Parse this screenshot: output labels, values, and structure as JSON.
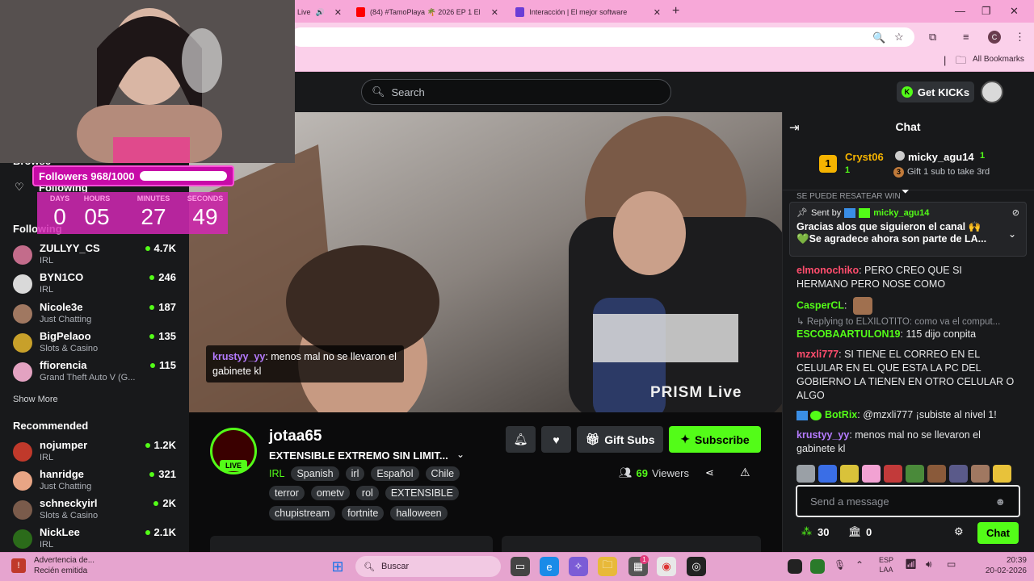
{
  "browser": {
    "tabs": [
      {
        "label": "(84) #TamoPlaya 🌴 2026 EP 1 El",
        "icon": "youtube-icon",
        "color": "#ff0000"
      },
      {
        "label": "Interacción | El mejor software",
        "icon": "app-icon",
        "color": "#6a3dd6"
      }
    ],
    "partial_tab_label": "Live",
    "bookmarks_label": "All Bookmarks",
    "profile_initial": "C"
  },
  "header": {
    "search_placeholder": "Search",
    "get_kicks_label": "Get KICKs"
  },
  "overlay": {
    "followers_label": "Followers 968/1000",
    "followers_progress": 0.968,
    "countdown": [
      {
        "label": "DAYS",
        "value": "0"
      },
      {
        "label": "HOURS",
        "value": "05"
      },
      {
        "label": "MINUTES",
        "value": "27"
      },
      {
        "label": "SECONDS",
        "value": "49"
      }
    ],
    "hidden_sidebar_fragment": "Browse",
    "following_nav_label": "Following"
  },
  "sidebar": {
    "following_heading": "Following",
    "following": [
      {
        "name": "ZULLYY_CS",
        "category": "IRL",
        "viewers": "4.7K",
        "color": "#c36c8b"
      },
      {
        "name": "BYN1CO",
        "category": "IRL",
        "viewers": "246",
        "color": "#d9d9d9"
      },
      {
        "name": "Nicole3e",
        "category": "Just Chatting",
        "viewers": "187",
        "color": "#a07861"
      },
      {
        "name": "BigPelaoo",
        "category": "Slots & Casino",
        "viewers": "135",
        "color": "#c8a02a"
      },
      {
        "name": "ffiorencia",
        "category": "Grand Theft Auto V (G...",
        "viewers": "115",
        "color": "#e3a2c1"
      }
    ],
    "show_more_label": "Show More",
    "recommended_heading": "Recommended",
    "recommended": [
      {
        "name": "nojumper",
        "category": "IRL",
        "viewers": "1.2K",
        "color": "#c0392b"
      },
      {
        "name": "hanridge",
        "category": "Just Chatting",
        "viewers": "321",
        "color": "#e8a585"
      },
      {
        "name": "schneckyirl",
        "category": "Slots & Casino",
        "viewers": "2K",
        "color": "#7a5b4b"
      },
      {
        "name": "NickLee",
        "category": "IRL",
        "viewers": "2.1K",
        "color": "#53fc18"
      }
    ]
  },
  "video": {
    "overlay_user": "krustyy_yy",
    "overlay_text": ": menos mal no se llevaron el gabinete kl",
    "watermark": "PRISM Live"
  },
  "channel": {
    "name": "jotaa65",
    "live_label": "LIVE",
    "title": "EXTENSIBLE EXTREMO SIN LIMIT...",
    "category": "IRL",
    "tags_row1": [
      "Spanish",
      "irl",
      "Español",
      "Chile"
    ],
    "tags_row2": [
      "terror",
      "ometv",
      "rol",
      "EXTENSIBLE"
    ],
    "tags_row3": [
      "chupistream",
      "fortnite",
      "halloween"
    ],
    "gift_subs_label": "Gift Subs",
    "subscribe_label": "Subscribe",
    "viewers_count": "69",
    "viewers_label": "Viewers"
  },
  "chat": {
    "title": "Chat",
    "leaderboard": {
      "first_user": "Cryst06",
      "first_count": "1",
      "second_user": "micky_agu14",
      "second_count": "1",
      "gift_prompt": "Gift 1 sub to take 3rd",
      "rank1": "1",
      "rank3": "3"
    },
    "cut_line": "SE PUEDE RESATEAR WIN",
    "pinned": {
      "sent_by_label": "Sent by",
      "user": "micky_agu14",
      "line1": "Gracias alos que siguieron el canal 🙌",
      "line2": "💚Se agradece ahora son parte de LA..."
    },
    "messages": [
      {
        "user": "elmonochiko",
        "text": ": PERO CREO QUE SI HERMANO PERO NOSE COMO",
        "color": "#ff4d6d"
      },
      {
        "user": "CasperCL",
        "text": ":",
        "color": "#53fc18"
      },
      {
        "reply": "Replying to ELXILOTITO: como va el comput..."
      },
      {
        "user": "ESCOBAARTULON19",
        "text": ": 115 dijo conpita",
        "color": "#53fc18"
      },
      {
        "user": "mzxli777",
        "text": ": SI TIENE EL CORREO EN EL CELULAR EN EL QUE ESTA LA PC DEL GOBIERNO LA TIENEN EN OTRO CELULAR O ALGO",
        "color": "#ff4d6d"
      },
      {
        "user": "BotRix",
        "text": ": @mzxli777 ¡subiste al nivel 1!",
        "color": "#53fc18"
      },
      {
        "user": "krustyy_yy",
        "text": ": menos mal no se llevaron el gabinete kl",
        "color": "#b57bff"
      }
    ],
    "input_placeholder": "Send a message",
    "points": "30",
    "drops": "0",
    "send_label": "Chat"
  },
  "taskbar": {
    "notif_title": "Advertencia de...",
    "notif_sub": "Recién emitida",
    "search_label": "Buscar",
    "lang_line1": "ESP",
    "lang_line2": "LAA",
    "time": "20:39",
    "date": "20-02-2026",
    "badge_count": "1"
  },
  "colors": {
    "kick_green": "#53fc18",
    "browser_pink": "#f7a8d8",
    "overlay_magenta": "#c70aa7"
  }
}
